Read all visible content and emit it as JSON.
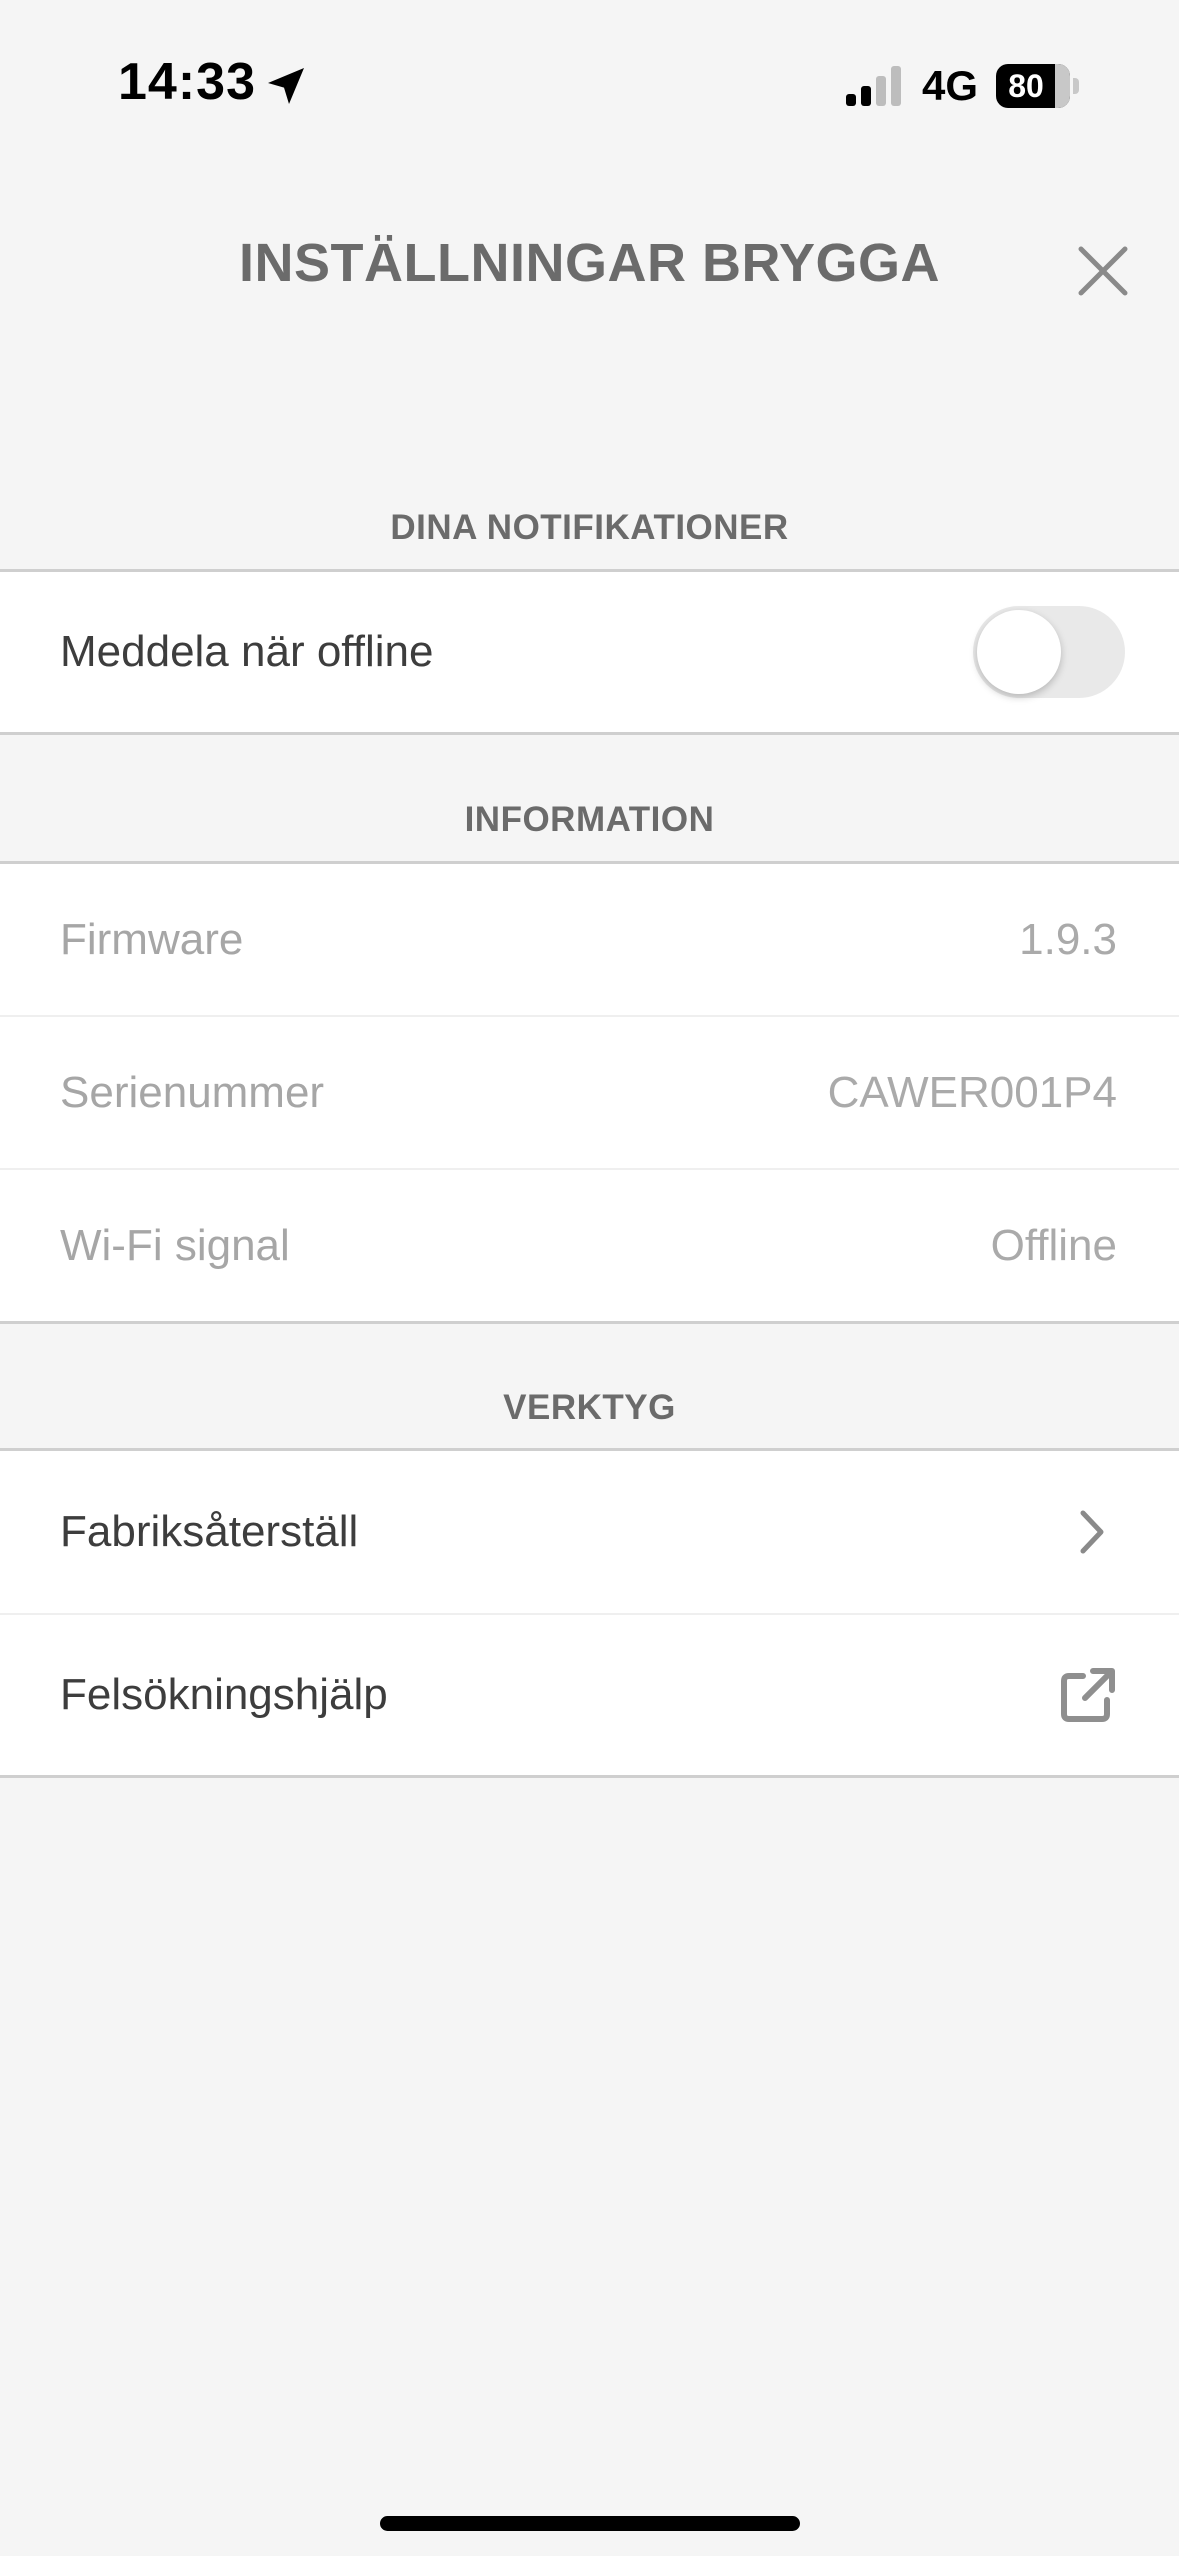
{
  "status_bar": {
    "time": "14:33",
    "network": "4G",
    "battery_percent": "80",
    "battery_level": 0.8,
    "location_icon": "location-arrow-icon",
    "signal_icon": "cellular-signal-icon"
  },
  "header": {
    "title": "INSTÄLLNINGAR BRYGGA",
    "close_icon": "close-icon"
  },
  "sections": {
    "notifications": {
      "title": "DINA NOTIFIKATIONER",
      "offline_label": "Meddela när offline",
      "offline_toggle_on": false
    },
    "information": {
      "title": "INFORMATION",
      "rows": [
        {
          "label": "Firmware",
          "value": "1.9.3"
        },
        {
          "label": "Serienummer",
          "value": "CAWER001P4"
        },
        {
          "label": "Wi-Fi signal",
          "value": "Offline"
        }
      ]
    },
    "tools": {
      "title": "VERKTYG",
      "factory_reset_label": "Fabriksåterställ",
      "factory_reset_icon": "chevron-right-icon",
      "troubleshooting_label": "Felsökningshjälp",
      "troubleshooting_icon": "external-link-icon"
    }
  },
  "colors": {
    "background": "#f5f5f5",
    "card": "#ffffff",
    "title_gray": "#6b6b6b",
    "muted_text": "#aaaaaa",
    "toggle_off": "#e9e9e9"
  }
}
